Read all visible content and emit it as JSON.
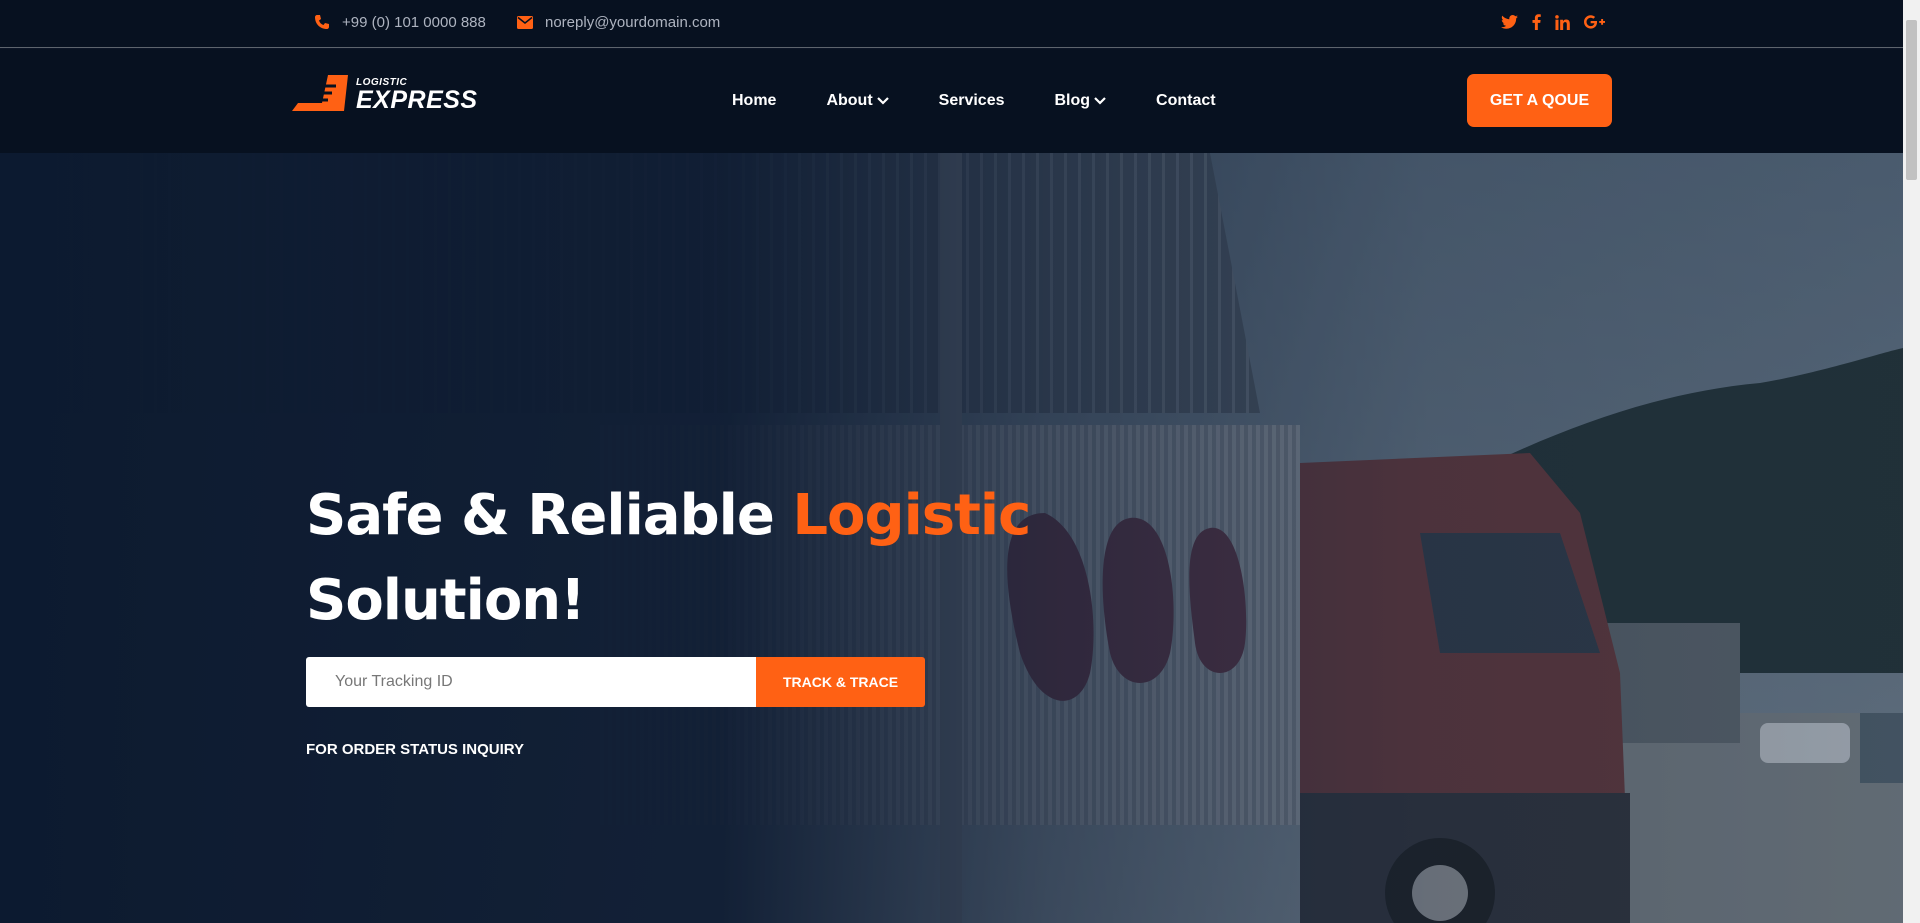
{
  "topbar": {
    "phone": "+99 (0) 101 0000 888",
    "email": "noreply@yourdomain.com",
    "socials": [
      "twitter-icon",
      "facebook-icon",
      "linkedin-icon",
      "google-plus-icon"
    ]
  },
  "header": {
    "logo_small": "LOGISTIC",
    "logo_big": "EXPRESS",
    "nav": {
      "home": "Home",
      "about": "About",
      "services": "Services",
      "blog": "Blog",
      "contact": "Contact"
    },
    "quote_button": "GET A QOUE"
  },
  "hero": {
    "title_part1": "Safe & Reliable ",
    "title_accent": "Logistic",
    "title_part2": "Solution!",
    "tracking_placeholder": "Your Tracking ID",
    "track_button": "TRACK & TRACE",
    "order_note": "FOR ORDER STATUS INQUIRY"
  },
  "colors": {
    "accent": "#ff6114",
    "dark": "#071120"
  }
}
